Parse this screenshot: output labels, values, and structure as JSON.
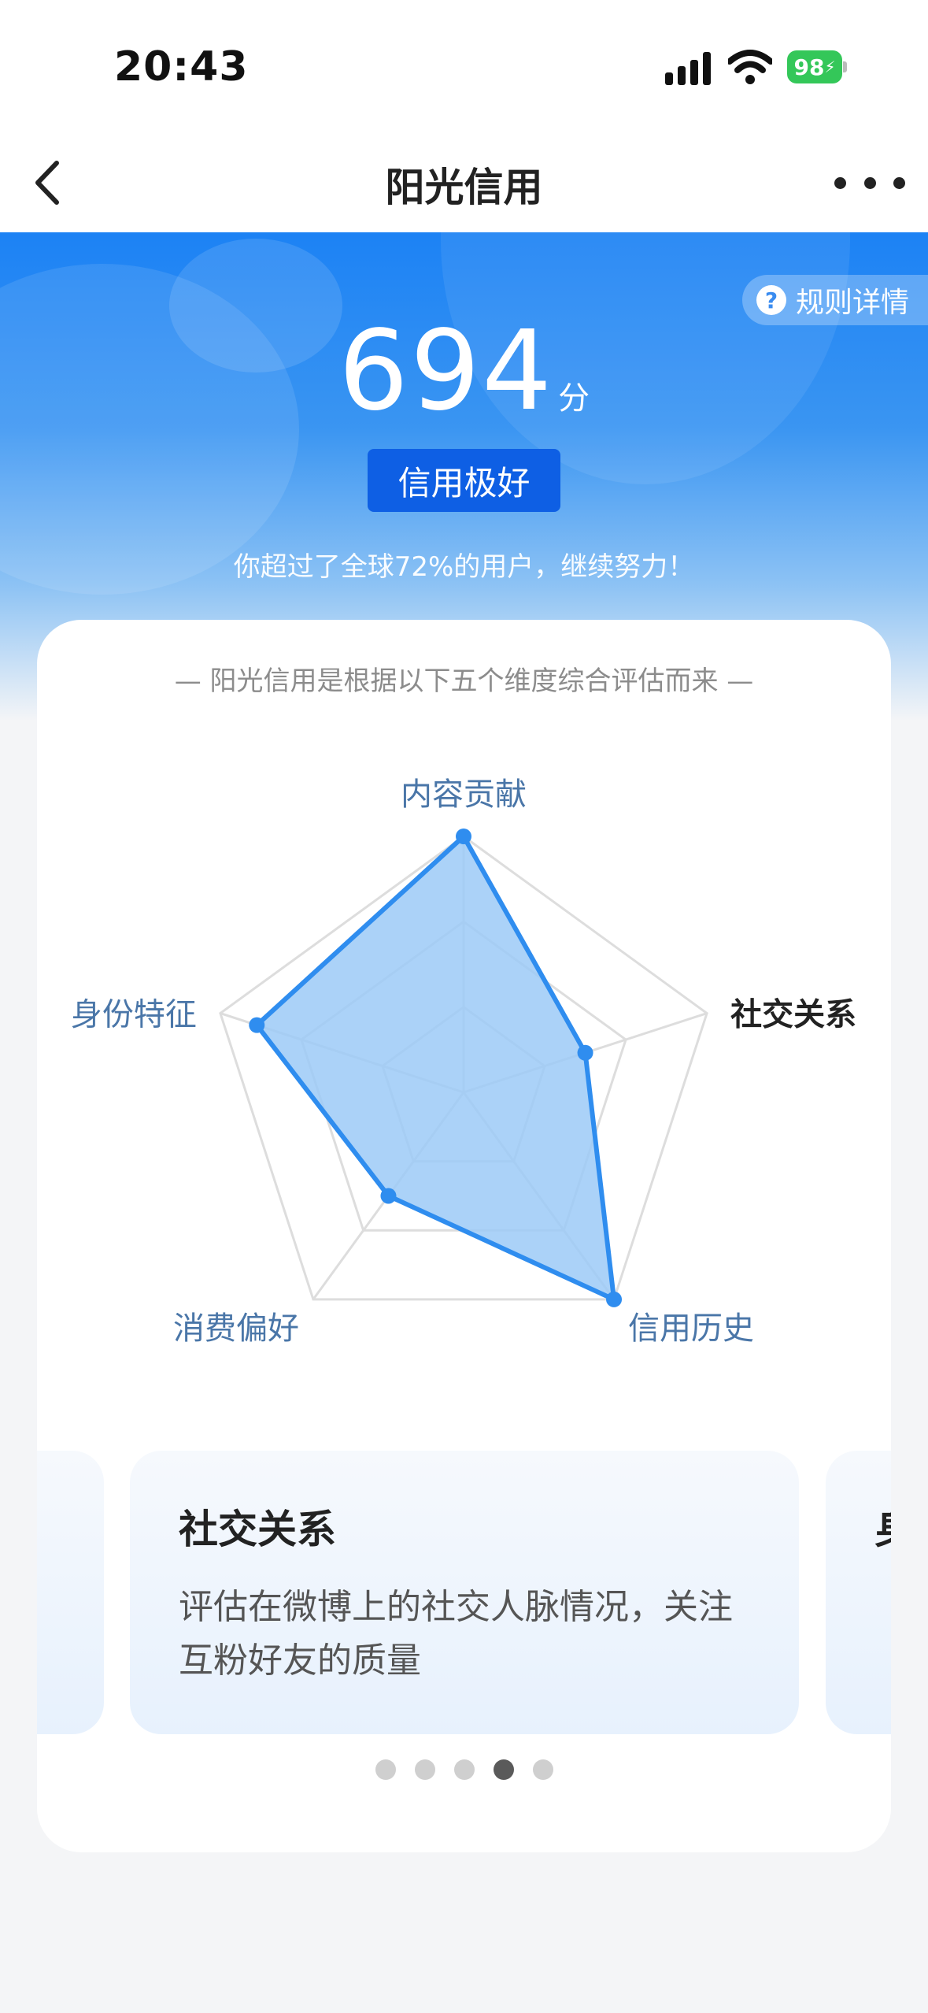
{
  "status_bar": {
    "time": "20:43",
    "battery": "98"
  },
  "nav": {
    "title": "阳光信用"
  },
  "hero": {
    "rules_label": "规则详情",
    "score": "694",
    "score_unit": "分",
    "level": "信用极好",
    "rank_text": "你超过了全球72%的用户，继续努力！"
  },
  "card": {
    "caption": "— 阳光信用是根据以下五个维度综合评估而来 —",
    "radar": {
      "type": "radar",
      "axes": [
        "内容贡献",
        "社交关系",
        "信用历史",
        "消费偏好",
        "身份特征"
      ],
      "values": [
        1.0,
        0.5,
        1.0,
        0.5,
        0.85
      ],
      "max": 1.0,
      "highlight_axis": "社交关系",
      "colors": {
        "fill": "#9ccaf7",
        "stroke": "#2f8def",
        "grid": "#dddddd",
        "label": "#4a76a8",
        "label_active": "#222222"
      }
    },
    "slides": [
      {
        "title": "",
        "desc": ""
      },
      {
        "title": "社交关系",
        "desc": "评估在微博上的社交人脉情况，关注互粉好友的质量"
      },
      {
        "title": "身",
        "desc": ""
      }
    ],
    "dots": {
      "count": 5,
      "active": 3
    }
  }
}
